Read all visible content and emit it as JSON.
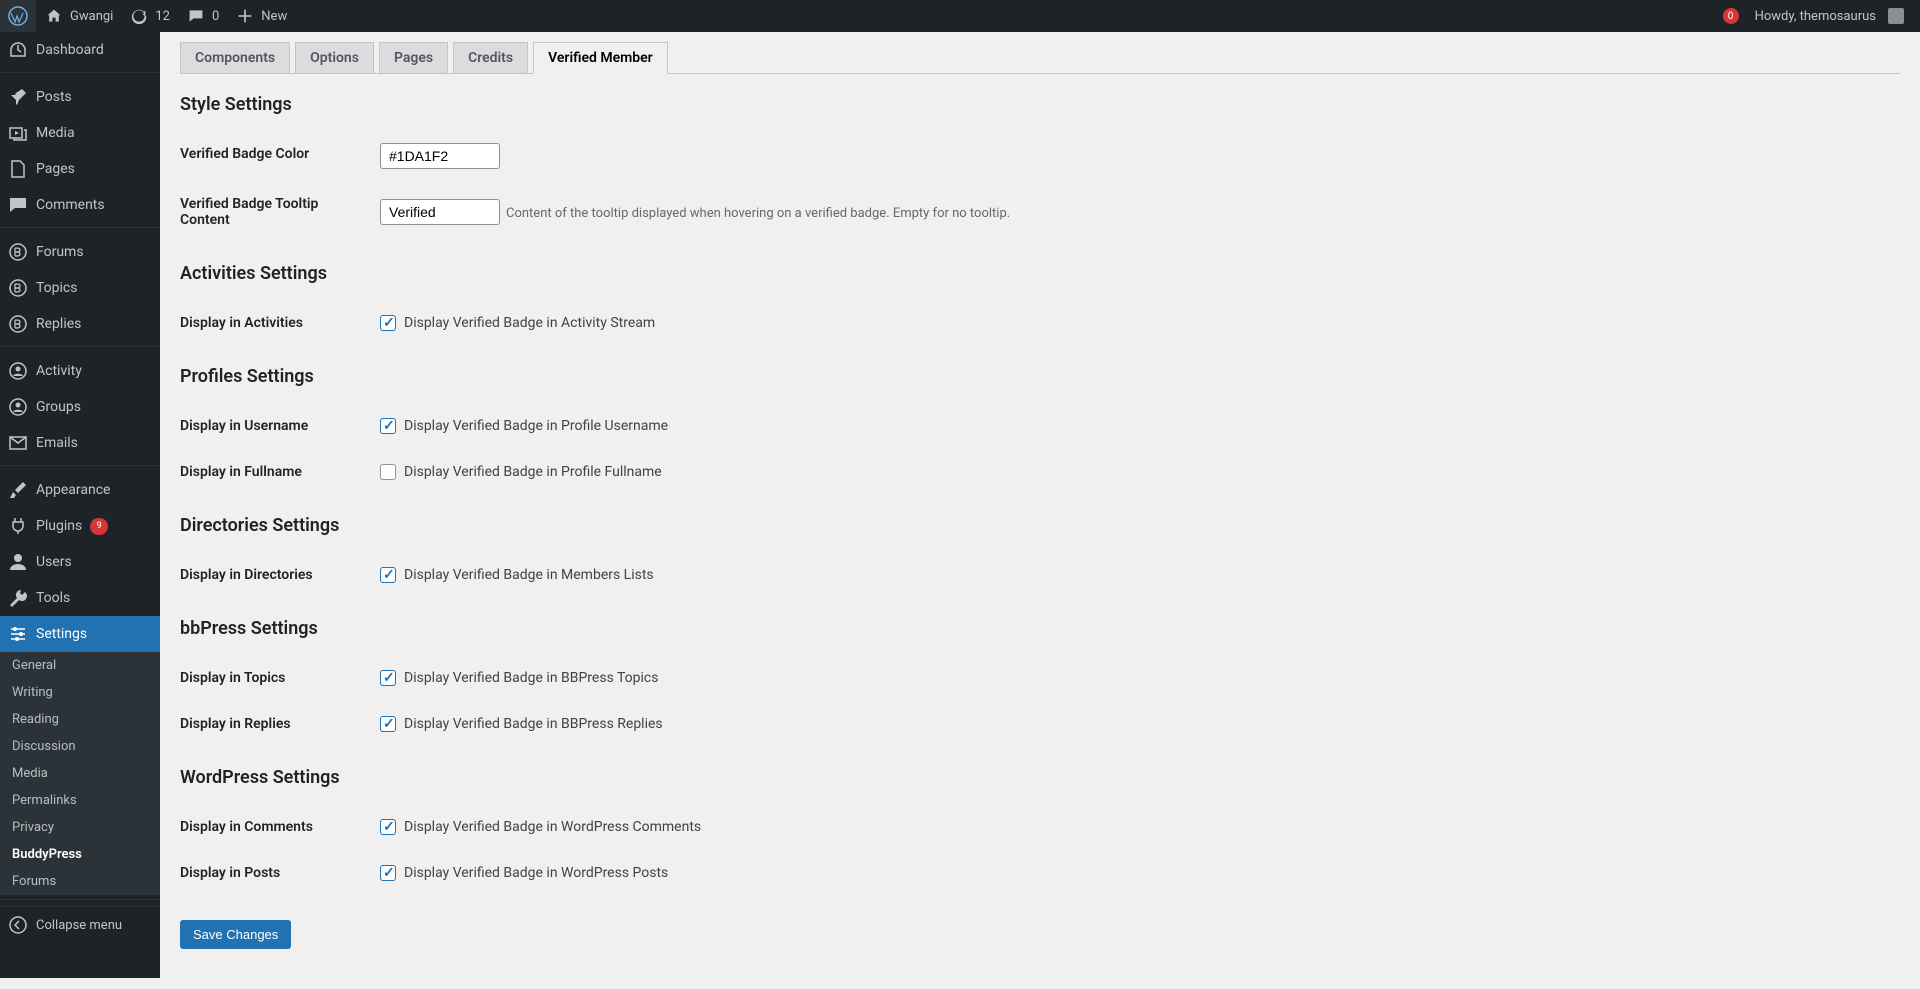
{
  "toolbar": {
    "site_name": "Gwangi",
    "updates": "12",
    "comments": "0",
    "new": "New",
    "howdy": "Howdy, themosaurus",
    "notif": "0"
  },
  "sidebar": {
    "dashboard": "Dashboard",
    "posts": "Posts",
    "media": "Media",
    "pages": "Pages",
    "comments": "Comments",
    "forums": "Forums",
    "topics": "Topics",
    "replies": "Replies",
    "activity": "Activity",
    "groups": "Groups",
    "emails": "Emails",
    "appearance": "Appearance",
    "plugins": "Plugins",
    "plugins_count": "9",
    "users": "Users",
    "tools": "Tools",
    "settings": "Settings",
    "collapse": "Collapse menu"
  },
  "submenu": {
    "general": "General",
    "writing": "Writing",
    "reading": "Reading",
    "discussion": "Discussion",
    "media": "Media",
    "permalinks": "Permalinks",
    "privacy": "Privacy",
    "buddypress": "BuddyPress",
    "forums": "Forums"
  },
  "tabs": {
    "components": "Components",
    "options": "Options",
    "pages": "Pages",
    "credits": "Credits",
    "verified": "Verified Member"
  },
  "sections": {
    "style": "Style Settings",
    "activities": "Activities Settings",
    "profiles": "Profiles Settings",
    "directories": "Directories Settings",
    "bbpress": "bbPress Settings",
    "wordpress": "WordPress Settings"
  },
  "fields": {
    "badge_color": {
      "label": "Verified Badge Color",
      "value": "#1DA1F2"
    },
    "badge_tooltip": {
      "label": "Verified Badge Tooltip Content",
      "value": "Verified",
      "desc": "Content of the tooltip displayed when hovering on a verified badge. Empty for no tooltip."
    },
    "activities": {
      "label": "Display in Activities",
      "cb": "Display Verified Badge in Activity Stream"
    },
    "username": {
      "label": "Display in Username",
      "cb": "Display Verified Badge in Profile Username"
    },
    "fullname": {
      "label": "Display in Fullname",
      "cb": "Display Verified Badge in Profile Fullname"
    },
    "directories": {
      "label": "Display in Directories",
      "cb": "Display Verified Badge in Members Lists"
    },
    "topics_f": {
      "label": "Display in Topics",
      "cb": "Display Verified Badge in BBPress Topics"
    },
    "replies_f": {
      "label": "Display in Replies",
      "cb": "Display Verified Badge in BBPress Replies"
    },
    "comments_f": {
      "label": "Display in Comments",
      "cb": "Display Verified Badge in WordPress Comments"
    },
    "posts_f": {
      "label": "Display in Posts",
      "cb": "Display Verified Badge in WordPress Posts"
    }
  },
  "save": "Save Changes"
}
